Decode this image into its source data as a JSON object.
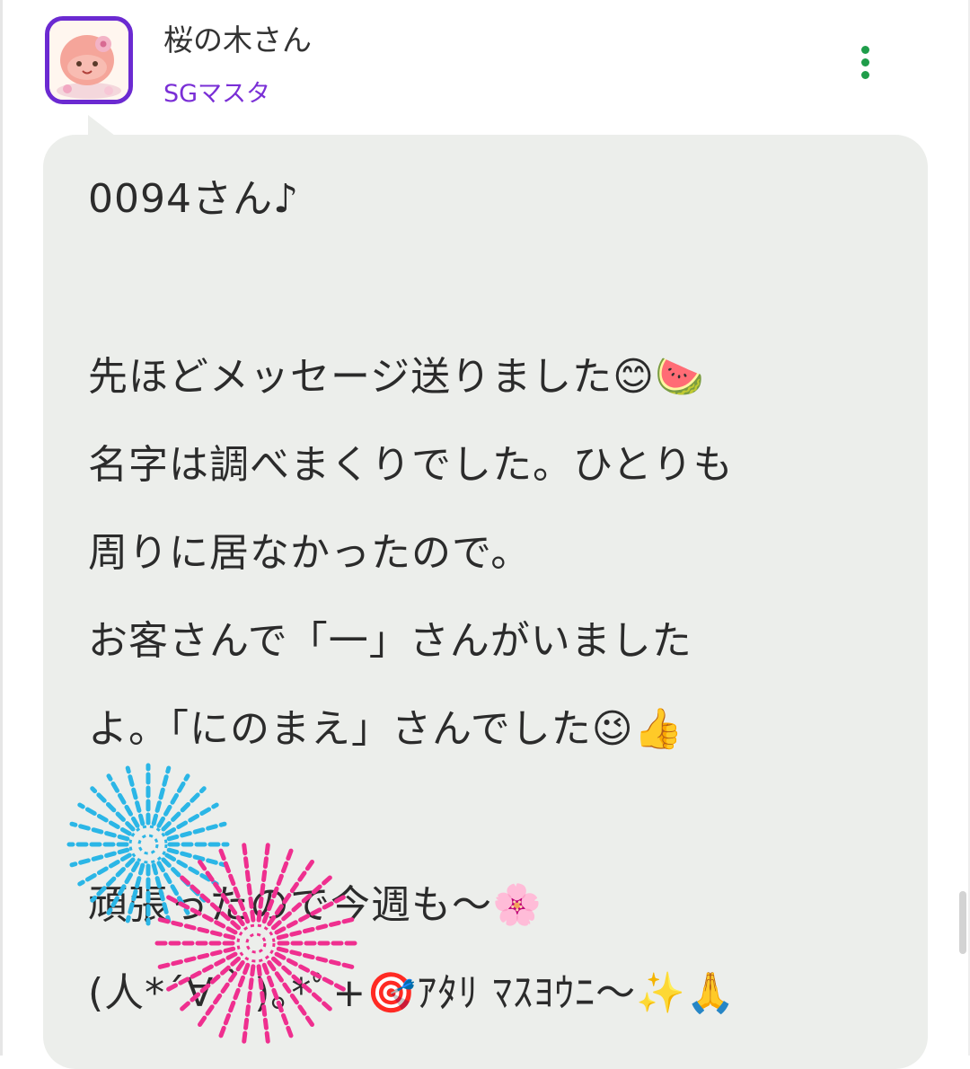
{
  "post": {
    "user_name": "桜の木さん",
    "user_role": "SGマスタ",
    "message_lines": [
      "0094さん♪",
      "",
      "先ほどメッセージ送りました😊🍉",
      "名字は調べまくりでした。ひとりも",
      "周りに居なかったので。",
      "お客さんで「一」さんがいました",
      "よ。「にのまえ」さんでした😉👍",
      "",
      "頑張ったので今週も〜🌸",
      "(人*´∀｀)｡*ﾟ+🎯ｱﾀﾘ ﾏｽﾖｳﾆ〜✨🙏"
    ]
  },
  "icons": {
    "menu": "more-vertical-icon",
    "avatar": "character-avatar",
    "stickers": [
      "blue-firework-icon",
      "pink-firework-icon"
    ]
  },
  "colors": {
    "accent": "#6b2ad1",
    "role_text": "#7a2fd6",
    "menu_dots": "#1f9d4a",
    "bubble_bg": "#eceeeb",
    "firework_blue": "#2bb6e6",
    "firework_pink": "#ef2f8f"
  }
}
